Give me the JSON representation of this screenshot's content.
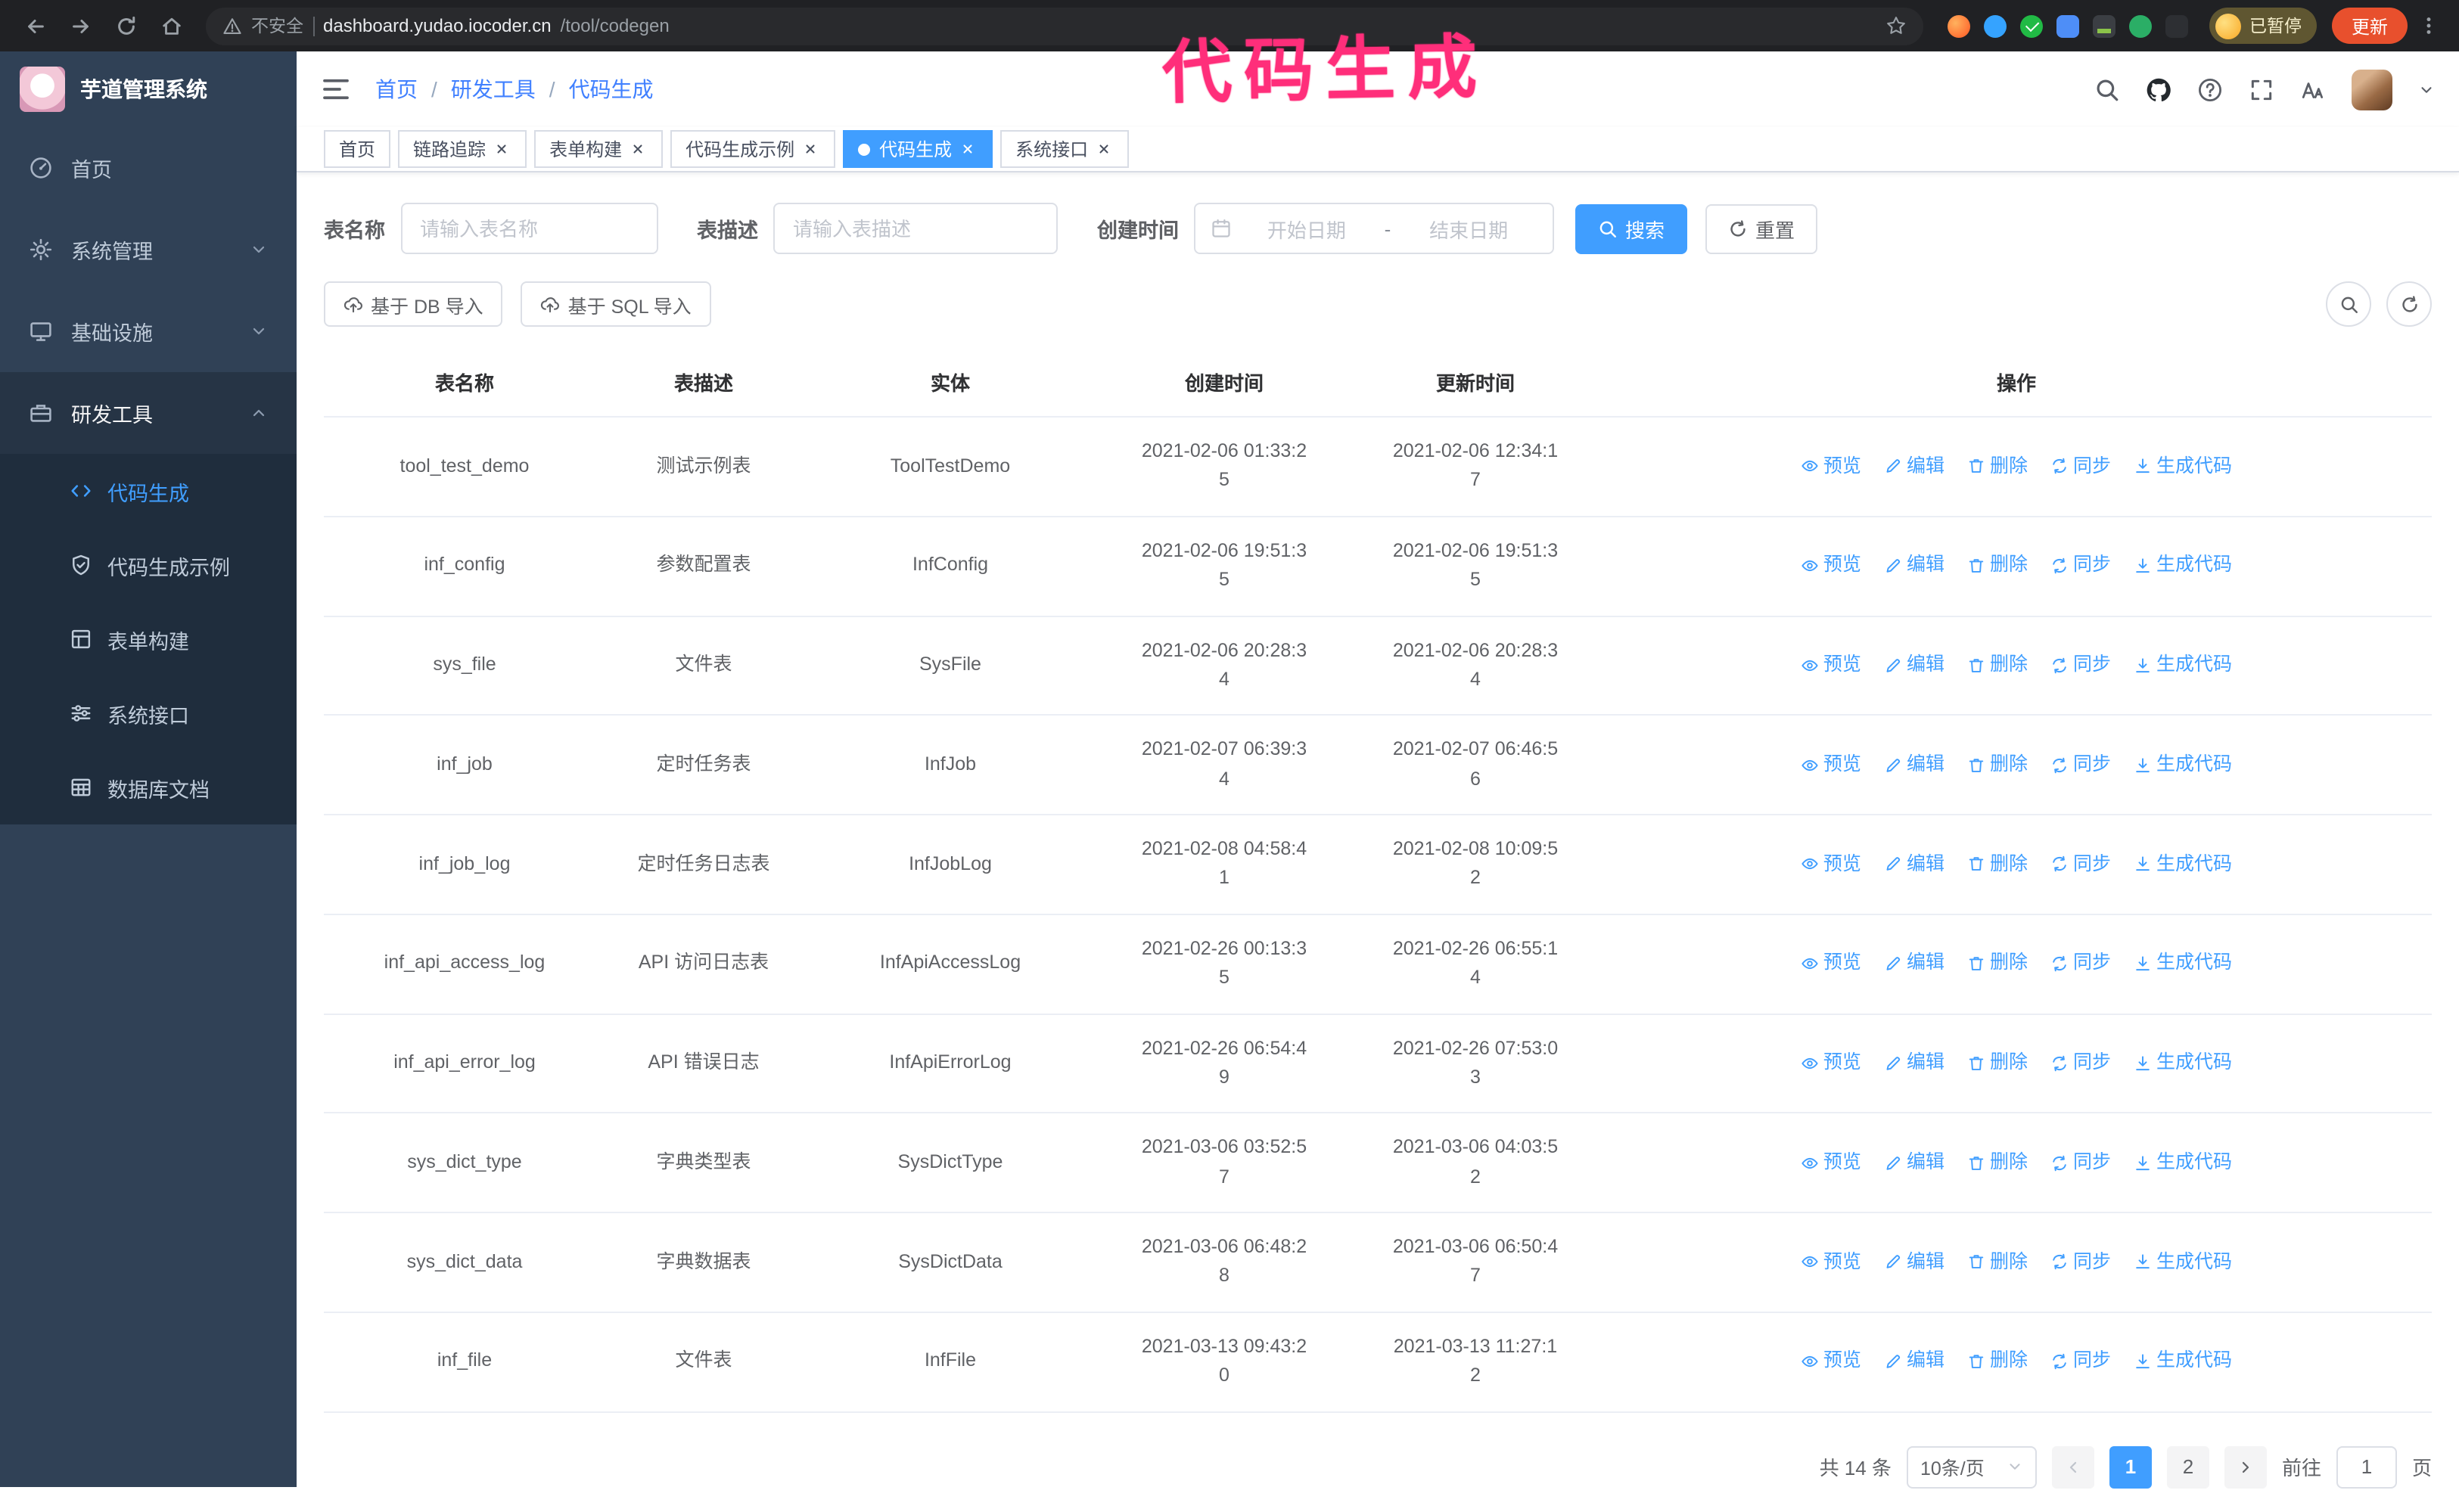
{
  "annotation": "代码生成",
  "browser": {
    "security_label": "不安全",
    "url_domain": "dashboard.yudao.iocoder.cn",
    "url_path": "/tool/codegen",
    "profile_status": "已暂停",
    "update_label": "更新"
  },
  "app": {
    "logo_title": "芋道管理系统"
  },
  "sidebar": {
    "items": [
      {
        "label": "首页"
      },
      {
        "label": "系统管理"
      },
      {
        "label": "基础设施"
      },
      {
        "label": "研发工具"
      }
    ],
    "submenu": [
      {
        "label": "代码生成",
        "active": true
      },
      {
        "label": "代码生成示例"
      },
      {
        "label": "表单构建"
      },
      {
        "label": "系统接口"
      },
      {
        "label": "数据库文档"
      }
    ]
  },
  "breadcrumb": {
    "items": [
      "首页",
      "研发工具",
      "代码生成"
    ],
    "separator": "/"
  },
  "tabs": [
    {
      "label": "首页",
      "closable": false,
      "active": false
    },
    {
      "label": "链路追踪",
      "closable": true,
      "active": false
    },
    {
      "label": "表单构建",
      "closable": true,
      "active": false
    },
    {
      "label": "代码生成示例",
      "closable": true,
      "active": false
    },
    {
      "label": "代码生成",
      "closable": true,
      "active": true
    },
    {
      "label": "系统接口",
      "closable": true,
      "active": false
    }
  ],
  "filters": {
    "table_name": {
      "label": "表名称",
      "placeholder": "请输入表名称",
      "value": ""
    },
    "table_desc": {
      "label": "表描述",
      "placeholder": "请输入表描述",
      "value": ""
    },
    "create_time": {
      "label": "创建时间",
      "start_placeholder": "开始日期",
      "separator": "-",
      "end_placeholder": "结束日期"
    },
    "search_label": "搜索",
    "reset_label": "重置"
  },
  "toolbar": {
    "import_db_label": "基于 DB 导入",
    "import_sql_label": "基于 SQL 导入"
  },
  "table": {
    "columns": [
      "表名称",
      "表描述",
      "实体",
      "创建时间",
      "更新时间",
      "操作"
    ],
    "actions": [
      "预览",
      "编辑",
      "删除",
      "同步",
      "生成代码"
    ],
    "rows": [
      {
        "name": "tool_test_demo",
        "desc": "测试示例表",
        "entity": "ToolTestDemo",
        "created": "2021-02-06 01:33:25",
        "updated": "2021-02-06 12:34:17"
      },
      {
        "name": "inf_config",
        "desc": "参数配置表",
        "entity": "InfConfig",
        "created": "2021-02-06 19:51:35",
        "updated": "2021-02-06 19:51:35"
      },
      {
        "name": "sys_file",
        "desc": "文件表",
        "entity": "SysFile",
        "created": "2021-02-06 20:28:34",
        "updated": "2021-02-06 20:28:34"
      },
      {
        "name": "inf_job",
        "desc": "定时任务表",
        "entity": "InfJob",
        "created": "2021-02-07 06:39:34",
        "updated": "2021-02-07 06:46:56"
      },
      {
        "name": "inf_job_log",
        "desc": "定时任务日志表",
        "entity": "InfJobLog",
        "created": "2021-02-08 04:58:41",
        "updated": "2021-02-08 10:09:52"
      },
      {
        "name": "inf_api_access_log",
        "desc": "API 访问日志表",
        "entity": "InfApiAccessLog",
        "created": "2021-02-26 00:13:35",
        "updated": "2021-02-26 06:55:14"
      },
      {
        "name": "inf_api_error_log",
        "desc": "API 错误日志",
        "entity": "InfApiErrorLog",
        "created": "2021-02-26 06:54:49",
        "updated": "2021-02-26 07:53:03"
      },
      {
        "name": "sys_dict_type",
        "desc": "字典类型表",
        "entity": "SysDictType",
        "created": "2021-03-06 03:52:57",
        "updated": "2021-03-06 04:03:52"
      },
      {
        "name": "sys_dict_data",
        "desc": "字典数据表",
        "entity": "SysDictData",
        "created": "2021-03-06 06:48:28",
        "updated": "2021-03-06 06:50:47"
      },
      {
        "name": "inf_file",
        "desc": "文件表",
        "entity": "InfFile",
        "created": "2021-03-13 09:43:20",
        "updated": "2021-03-13 11:27:12"
      }
    ]
  },
  "pagination": {
    "total_label": "共 14 条",
    "page_size_label": "10条/页",
    "pages": [
      {
        "label": "1",
        "active": true
      },
      {
        "label": "2",
        "active": false
      }
    ],
    "goto_label": "前往",
    "goto_value": "1",
    "goto_unit": "页"
  },
  "colors": {
    "primary": "#409eff",
    "annotation": "#ff2e7a",
    "sidebar_bg": "#304156",
    "submenu_bg": "#1f2d3d"
  }
}
